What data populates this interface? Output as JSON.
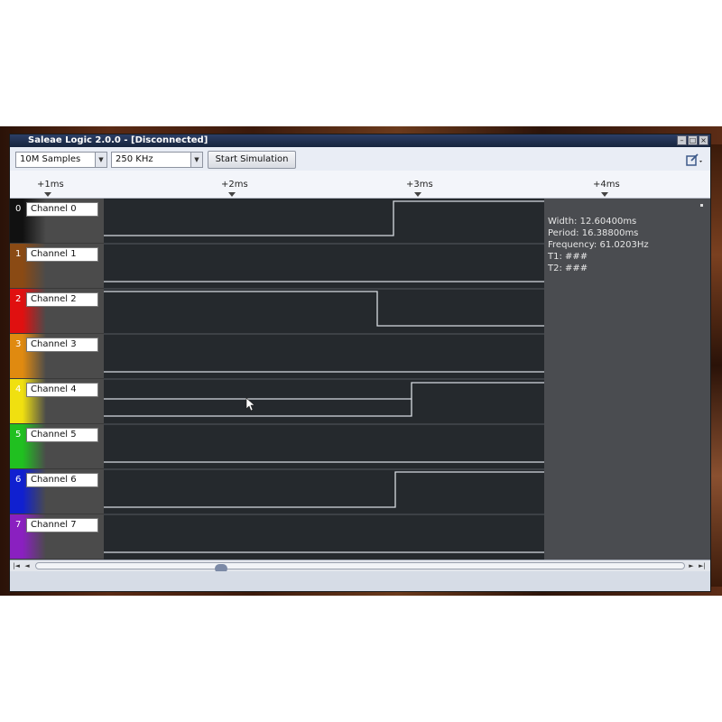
{
  "window": {
    "title": "Saleae Logic 2.0.0 - [Disconnected]",
    "minimize": "–",
    "maximize": "□",
    "close": "×"
  },
  "toolbar": {
    "samples_value": "10M Samples",
    "rate_value": "250 KHz",
    "start_label": "Start Simulation",
    "dropdown_arrow": "▼",
    "options_icon": "options-icon"
  },
  "ruler": {
    "ticks": [
      "+1ms",
      "+2ms",
      "+3ms",
      "+4ms"
    ]
  },
  "channels": [
    {
      "num": "0",
      "label": "Channel 0",
      "color": "#111111"
    },
    {
      "num": "1",
      "label": "Channel 1",
      "color": "#8a4a14"
    },
    {
      "num": "2",
      "label": "Channel 2",
      "color": "#e01010"
    },
    {
      "num": "3",
      "label": "Channel 3",
      "color": "#e08a10"
    },
    {
      "num": "4",
      "label": "Channel 4",
      "color": "#f0e010"
    },
    {
      "num": "5",
      "label": "Channel 5",
      "color": "#20c020"
    },
    {
      "num": "6",
      "label": "Channel 6",
      "color": "#1020d0"
    },
    {
      "num": "7",
      "label": "Channel 7",
      "color": "#8a20c0"
    }
  ],
  "measurements": {
    "width": "Width: 12.60400ms",
    "period": "Period: 16.38800ms",
    "frequency": "Frequency: 61.0203Hz",
    "t1": "T1: ###",
    "t2": "T2: ###"
  },
  "scrollbar": {
    "first": "|◄",
    "prev": "◄",
    "next": "►",
    "last": "►|"
  }
}
